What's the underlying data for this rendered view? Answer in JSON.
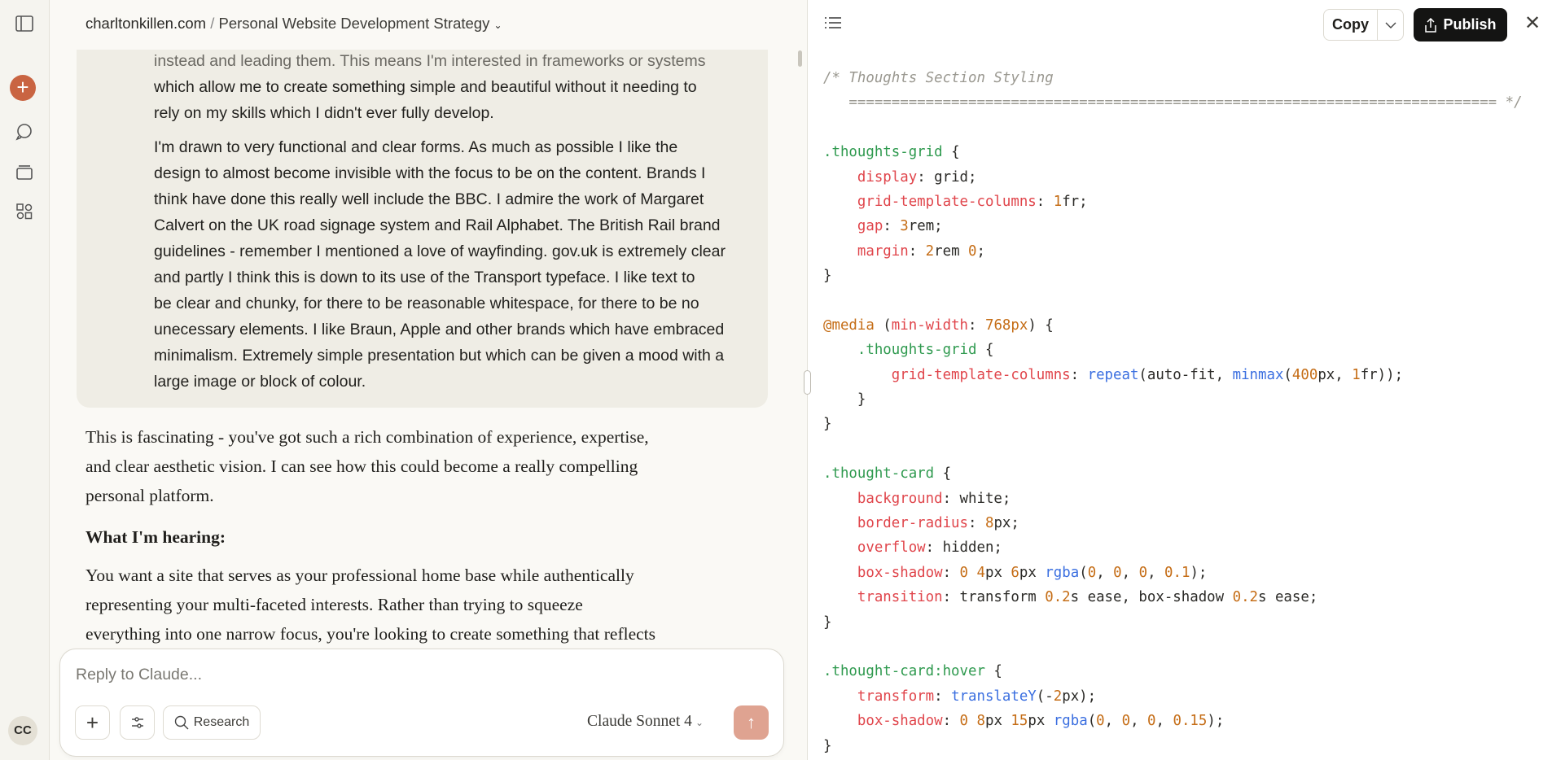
{
  "sidebar": {
    "icons": [
      "sidebar-toggle-icon",
      "new-chat-icon",
      "chats-icon",
      "projects-icon",
      "artifacts-icon"
    ],
    "avatar": "CC",
    "accent": "#c96442"
  },
  "header": {
    "project": "charltonkillen.com",
    "separator": "/",
    "title": "Personal Website Development Strategy"
  },
  "user_message": {
    "lines_1": [
      "instead and leading them. This means I'm interested in frameworks or systems",
      "which allow me to create something simple and beautiful without it needing to",
      "rely on my skills which I didn't ever fully develop."
    ],
    "lines_2": [
      "I'm drawn to very functional and clear forms. As much as possible I like the",
      "design to almost become invisible with the focus to be on the content. Brands I",
      "think have done this really well include the BBC. I admire the work of Margaret",
      "Calvert on the UK road signage system and Rail Alphabet. The British Rail brand",
      "guidelines - remember I mentioned a love of wayfinding. gov.uk is extremely clear",
      "and partly I think this is down to its use of the Transport typeface. I like text to",
      "be clear and chunky, for there to be reasonable whitespace, for there to be no",
      "unecessary elements. I like Braun, Apple and other brands which have embraced",
      "minimalism. Extremely simple presentation but which can be given a mood with a",
      "large image or block of colour."
    ]
  },
  "assistant_message": {
    "lines_1": [
      "This is fascinating - you've got such a rich combination of experience, expertise,",
      "and clear aesthetic vision. I can see how this could become a really compelling",
      "personal platform."
    ],
    "heading": "What I'm hearing:",
    "lines_2": [
      "You want a site that serves as your professional home base while authentically",
      "representing your multi-faceted interests. Rather than trying to squeeze",
      "everything into one narrow focus, you're looking to create something that reflects"
    ]
  },
  "composer": {
    "placeholder": "Reply to Claude...",
    "research_label": "Research",
    "model": "Claude Sonnet 4"
  },
  "artifact": {
    "copy_label": "Copy",
    "publish_label": "Publish",
    "code_lines": [
      [
        [
          "/* Thoughts Section Styling",
          "c"
        ]
      ],
      [
        [
          "   ============================================================================ */",
          "c"
        ]
      ],
      [],
      [
        [
          ".thoughts-grid",
          "s"
        ],
        [
          " {",
          ""
        ]
      ],
      [
        [
          "    ",
          ""
        ],
        [
          "display",
          "p"
        ],
        [
          ": grid;",
          ""
        ]
      ],
      [
        [
          "    ",
          ""
        ],
        [
          "grid-template-columns",
          "p"
        ],
        [
          ": ",
          ""
        ],
        [
          "1",
          "n"
        ],
        [
          "fr;",
          ""
        ]
      ],
      [
        [
          "    ",
          ""
        ],
        [
          "gap",
          "p"
        ],
        [
          ": ",
          ""
        ],
        [
          "3",
          "n"
        ],
        [
          "rem;",
          ""
        ]
      ],
      [
        [
          "    ",
          ""
        ],
        [
          "margin",
          "p"
        ],
        [
          ": ",
          ""
        ],
        [
          "2",
          "n"
        ],
        [
          "rem ",
          ""
        ],
        [
          "0",
          "n"
        ],
        [
          ";",
          ""
        ]
      ],
      [
        [
          "}",
          ""
        ]
      ],
      [],
      [
        [
          "@media",
          "a"
        ],
        [
          " (",
          ""
        ],
        [
          "min-width",
          "p"
        ],
        [
          ": ",
          ""
        ],
        [
          "768px",
          "n"
        ],
        [
          ") {",
          ""
        ]
      ],
      [
        [
          "    ",
          ""
        ],
        [
          ".thoughts-grid",
          "s"
        ],
        [
          " {",
          ""
        ]
      ],
      [
        [
          "        ",
          ""
        ],
        [
          "grid-template-columns",
          "p"
        ],
        [
          ": ",
          ""
        ],
        [
          "repeat",
          "f"
        ],
        [
          "(auto-fit, ",
          ""
        ],
        [
          "minmax",
          "f"
        ],
        [
          "(",
          ""
        ],
        [
          "400",
          "n"
        ],
        [
          "px, ",
          ""
        ],
        [
          "1",
          "n"
        ],
        [
          "fr));",
          ""
        ]
      ],
      [
        [
          "    }",
          ""
        ]
      ],
      [
        [
          "}",
          ""
        ]
      ],
      [],
      [
        [
          ".thought-card",
          "s"
        ],
        [
          " {",
          ""
        ]
      ],
      [
        [
          "    ",
          ""
        ],
        [
          "background",
          "p"
        ],
        [
          ": white;",
          ""
        ]
      ],
      [
        [
          "    ",
          ""
        ],
        [
          "border-radius",
          "p"
        ],
        [
          ": ",
          ""
        ],
        [
          "8",
          "n"
        ],
        [
          "px;",
          ""
        ]
      ],
      [
        [
          "    ",
          ""
        ],
        [
          "overflow",
          "p"
        ],
        [
          ": hidden;",
          ""
        ]
      ],
      [
        [
          "    ",
          ""
        ],
        [
          "box-shadow",
          "p"
        ],
        [
          ": ",
          ""
        ],
        [
          "0",
          "n"
        ],
        [
          " ",
          ""
        ],
        [
          "4",
          "n"
        ],
        [
          "px ",
          ""
        ],
        [
          "6",
          "n"
        ],
        [
          "px ",
          ""
        ],
        [
          "rgba",
          "f"
        ],
        [
          "(",
          ""
        ],
        [
          "0",
          "n"
        ],
        [
          ", ",
          ""
        ],
        [
          "0",
          "n"
        ],
        [
          ", ",
          ""
        ],
        [
          "0",
          "n"
        ],
        [
          ", ",
          ""
        ],
        [
          "0.1",
          "n"
        ],
        [
          ");",
          ""
        ]
      ],
      [
        [
          "    ",
          ""
        ],
        [
          "transition",
          "p"
        ],
        [
          ": transform ",
          ""
        ],
        [
          "0.2",
          "n"
        ],
        [
          "s ease, box-shadow ",
          ""
        ],
        [
          "0.2",
          "n"
        ],
        [
          "s ease;",
          ""
        ]
      ],
      [
        [
          "}",
          ""
        ]
      ],
      [],
      [
        [
          ".thought-card:hover",
          "s"
        ],
        [
          " {",
          ""
        ]
      ],
      [
        [
          "    ",
          ""
        ],
        [
          "transform",
          "p"
        ],
        [
          ": ",
          ""
        ],
        [
          "translateY",
          "f"
        ],
        [
          "(-",
          ""
        ],
        [
          "2",
          "n"
        ],
        [
          "px);",
          ""
        ]
      ],
      [
        [
          "    ",
          ""
        ],
        [
          "box-shadow",
          "p"
        ],
        [
          ": ",
          ""
        ],
        [
          "0",
          "n"
        ],
        [
          " ",
          ""
        ],
        [
          "8",
          "n"
        ],
        [
          "px ",
          ""
        ],
        [
          "15",
          "n"
        ],
        [
          "px ",
          ""
        ],
        [
          "rgba",
          "f"
        ],
        [
          "(",
          ""
        ],
        [
          "0",
          "n"
        ],
        [
          ", ",
          ""
        ],
        [
          "0",
          "n"
        ],
        [
          ", ",
          ""
        ],
        [
          "0",
          "n"
        ],
        [
          ", ",
          ""
        ],
        [
          "0.15",
          "n"
        ],
        [
          ");",
          ""
        ]
      ],
      [
        [
          "}",
          ""
        ]
      ]
    ]
  }
}
